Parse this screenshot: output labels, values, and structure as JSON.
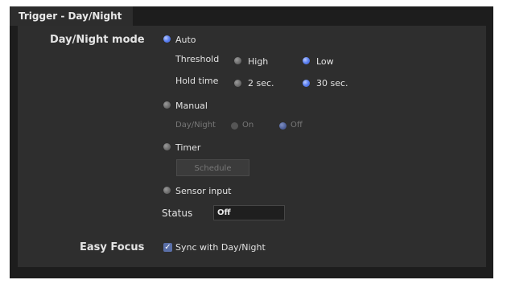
{
  "tab": {
    "title": "Trigger - Day/Night"
  },
  "day_night": {
    "label": "Day/Night mode",
    "auto_label": "Auto",
    "threshold": {
      "label": "Threshold",
      "options": [
        "High",
        "Low"
      ],
      "selected": "Low"
    },
    "hold_time": {
      "label": "Hold time",
      "options": [
        "2 sec.",
        "30 sec."
      ],
      "selected": "30 sec."
    },
    "manual_label": "Manual",
    "manual_day_night": {
      "label": "Day/Night",
      "options": [
        "On",
        "Off"
      ],
      "selected": "Off"
    },
    "timer_label": "Timer",
    "schedule_button": "Schedule",
    "sensor_label": "Sensor input",
    "selected_mode": "Auto",
    "status_label": "Status",
    "status_value": "Off"
  },
  "easy_focus": {
    "label": "Easy Focus",
    "checkbox_label": "Sync with Day/Night",
    "checked": true
  },
  "colors": {
    "accent": "#5a7ff0",
    "background": "#2e2e2e",
    "panel": "#1d1d1d"
  }
}
